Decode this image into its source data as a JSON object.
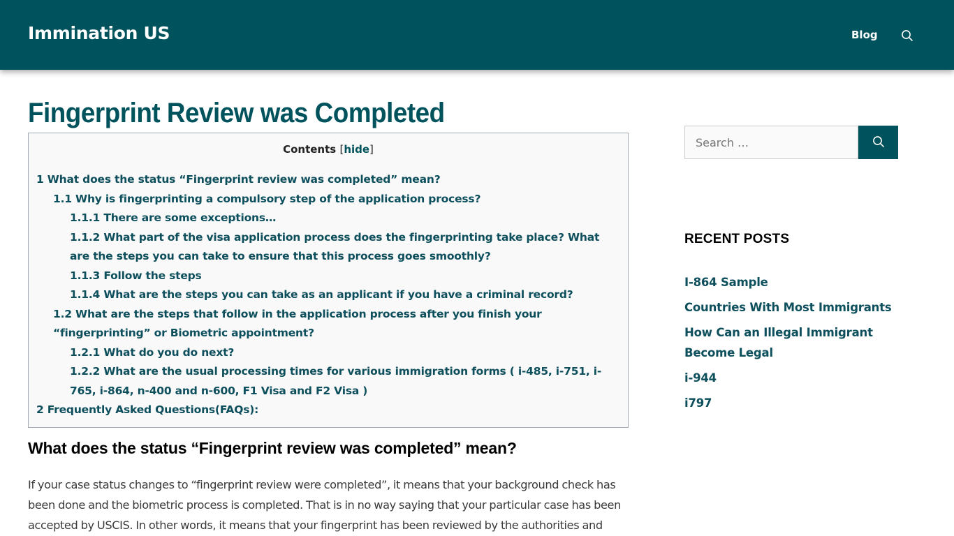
{
  "header": {
    "site_title": "Immination US",
    "nav": [
      {
        "label": "Blog"
      }
    ],
    "search_icon": "search-icon"
  },
  "colors": {
    "brand": "#00535c",
    "link": "#0d4f5c",
    "toc_bg": "#f9f9f9",
    "toc_border": "#a2a9b1"
  },
  "main": {
    "title": "Fingerprint Review was Completed",
    "toc": {
      "heading": "Contents",
      "bracket_open": "[",
      "toggle_label": "hide",
      "bracket_close": "]",
      "items": [
        {
          "level": 1,
          "label": "1 What does the status “Fingerprint review was completed” mean?"
        },
        {
          "level": 2,
          "label": "1.1 Why is fingerprinting a compulsory step of the application process?"
        },
        {
          "level": 3,
          "label": "1.1.1 There are some exceptions…"
        },
        {
          "level": 3,
          "label": "1.1.2 What part of the visa application process does the fingerprinting take place? What are the steps you can take to ensure that this process goes smoothly?"
        },
        {
          "level": 3,
          "label": "1.1.3 Follow the steps"
        },
        {
          "level": 3,
          "label": "1.1.4 What are the steps you can take as an applicant if you have a criminal record?"
        },
        {
          "level": 2,
          "label": "1.2 What are the steps that follow in the application process after you finish your “fingerprinting” or Biometric appointment?"
        },
        {
          "level": 3,
          "label": "1.2.1 What do you do next?"
        },
        {
          "level": 3,
          "label": "1.2.2 What are the usual processing times for various immigration forms ( i-485, i-751, i-765, i-864, n-400 and n-600, F1 Visa and F2 Visa )"
        },
        {
          "level": 1,
          "label": "2 Frequently Asked Questions(FAQs):"
        }
      ]
    },
    "section_heading": "What does the status “Fingerprint review was completed” mean?",
    "paragraph": "If your case status changes to “fingerprint review were completed”, it means that your background check has been done and the biometric process is completed. That is in no way saying that your particular case has been accepted by USCIS. In other words, it means that your fingerprint has been reviewed by the authorities and"
  },
  "sidebar": {
    "search": {
      "placeholder": "Search …",
      "value": "",
      "button_icon": "search-icon"
    },
    "recent_posts": {
      "title": "RECENT POSTS",
      "items": [
        {
          "label": "I-864 Sample"
        },
        {
          "label": "Countries With Most Immigrants"
        },
        {
          "label": "How Can an Illegal Immigrant Become Legal"
        },
        {
          "label": "i-944"
        },
        {
          "label": "i797"
        }
      ]
    }
  }
}
